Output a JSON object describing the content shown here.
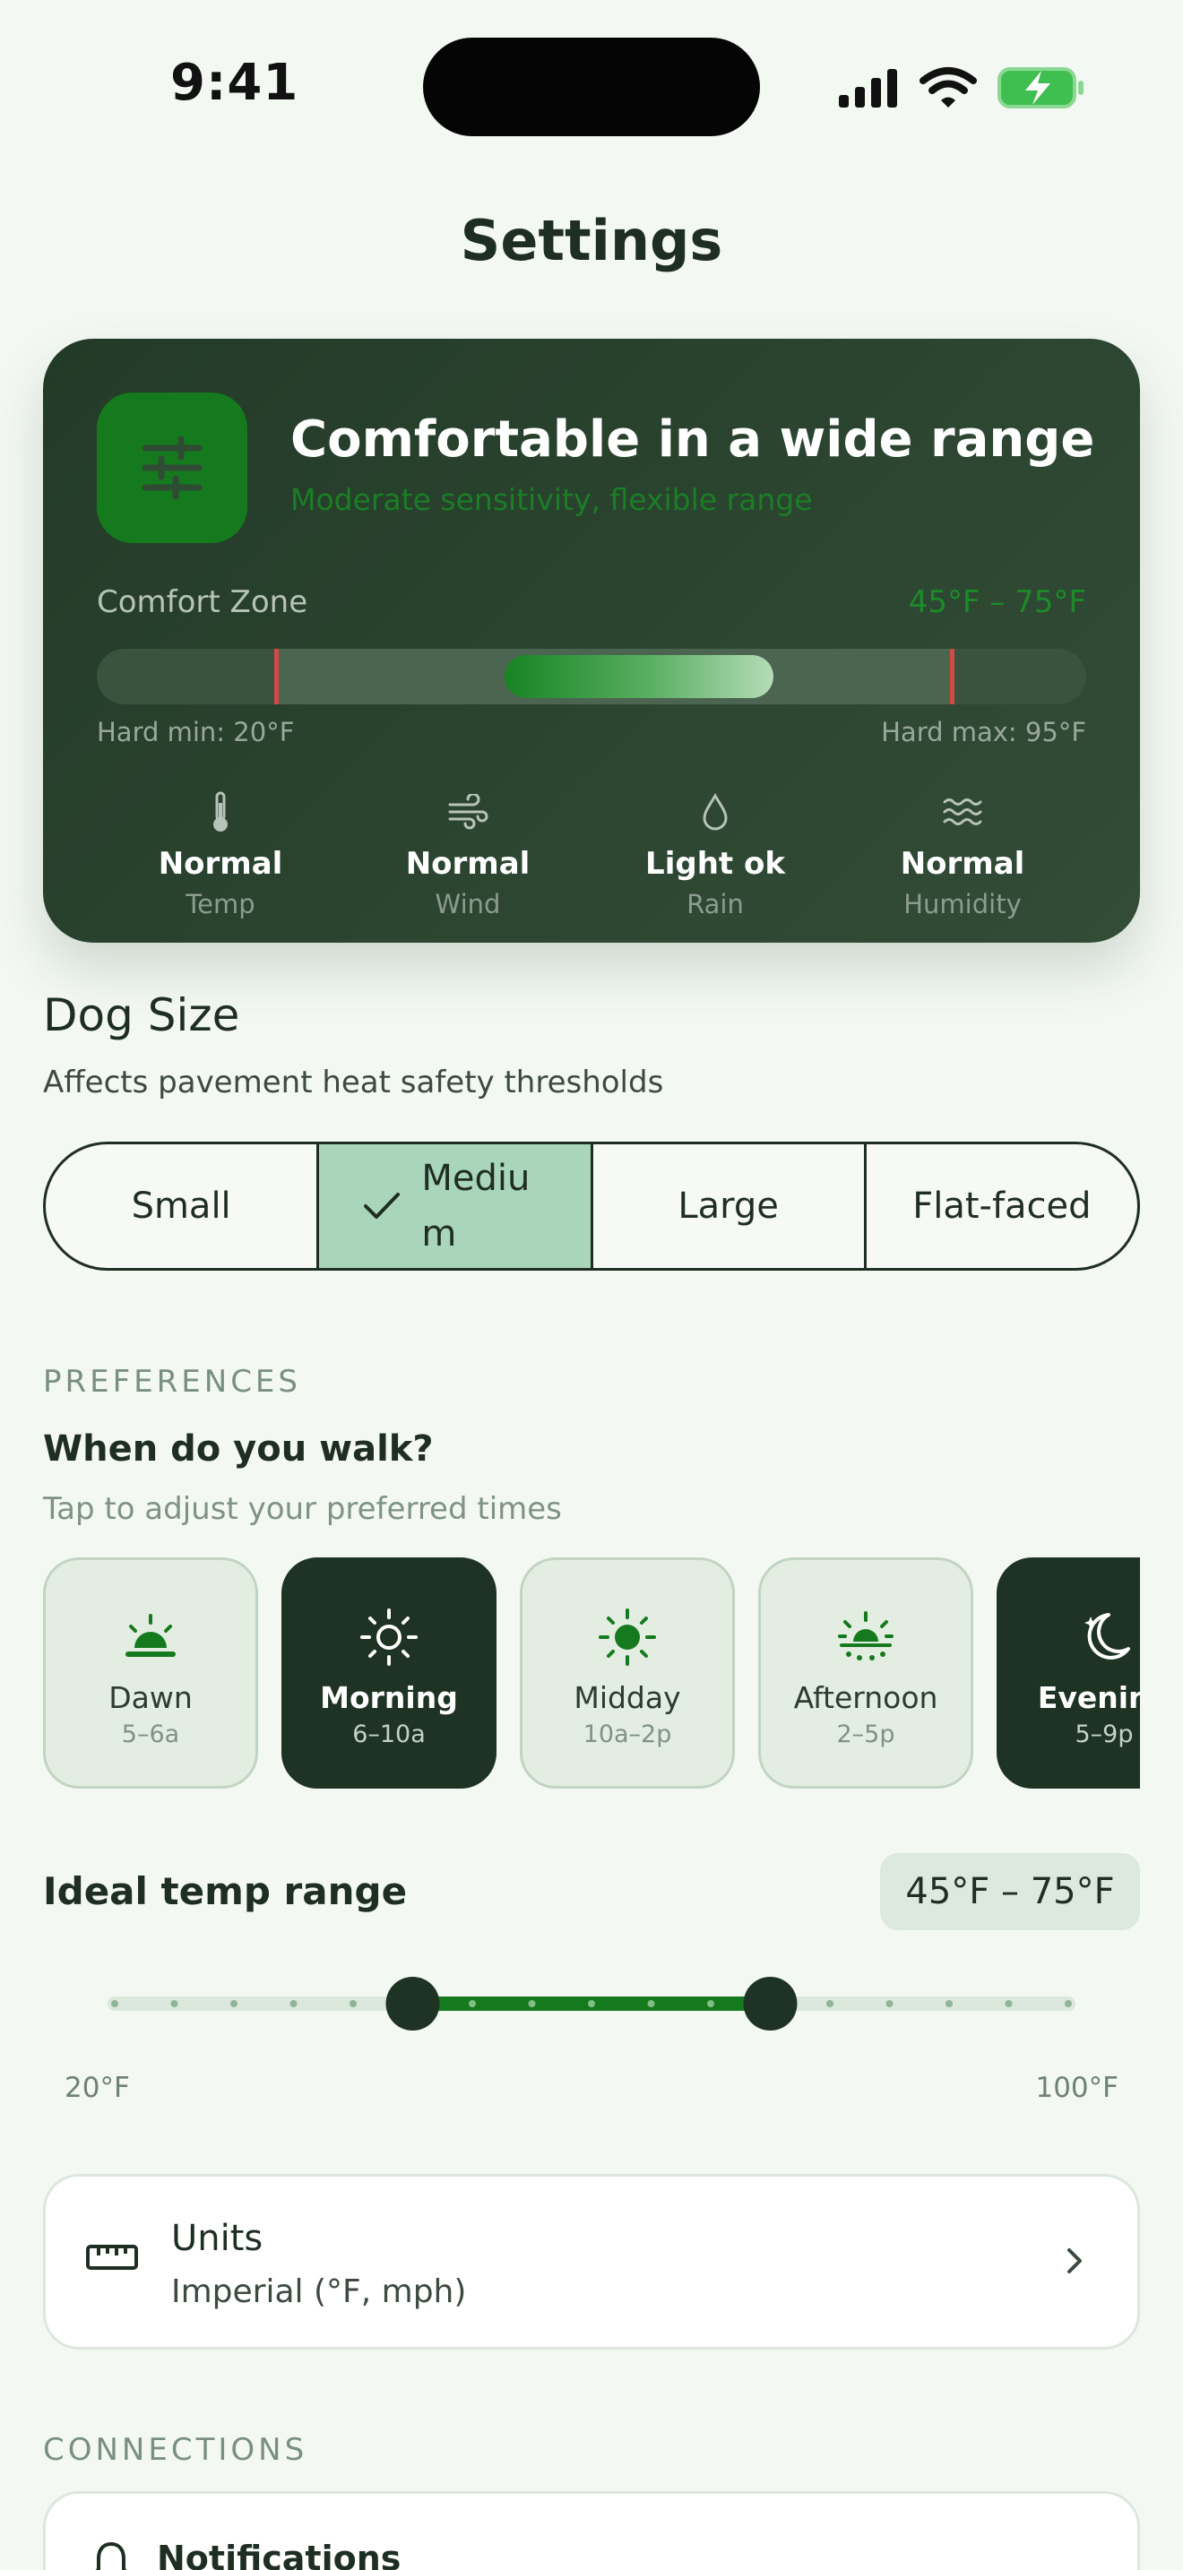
{
  "status_bar": {
    "time": "9:41"
  },
  "page_title": "Settings",
  "comfort_card": {
    "title": "Comfortable in a wide range",
    "subtitle": "Moderate sensitivity, flexible range",
    "zone_label": "Comfort Zone",
    "zone_range": "45°F – 75°F",
    "hard_min": "Hard min: 20°F",
    "hard_max": "Hard max: 95°F",
    "factors": [
      {
        "icon": "thermometer-icon",
        "value": "Normal",
        "label": "Temp"
      },
      {
        "icon": "wind-icon",
        "value": "Normal",
        "label": "Wind"
      },
      {
        "icon": "raindrop-icon",
        "value": "Light ok",
        "label": "Rain"
      },
      {
        "icon": "humidity-waves-icon",
        "value": "Normal",
        "label": "Humidity"
      }
    ]
  },
  "dog_size": {
    "title": "Dog Size",
    "subtitle": "Affects pavement heat safety thresholds",
    "options": [
      "Small",
      "Medium",
      "Large",
      "Flat-faced"
    ],
    "selected": "Medium"
  },
  "preferences": {
    "section_label": "PREFERENCES",
    "walk_title": "When do you walk?",
    "walk_subtitle": "Tap to adjust your preferred times",
    "times": [
      {
        "name": "Dawn",
        "range": "5–6a",
        "icon": "sunrise-icon",
        "selected": false
      },
      {
        "name": "Morning",
        "range": "6–10a",
        "icon": "sun-outline-icon",
        "selected": true
      },
      {
        "name": "Midday",
        "range": "10a–2p",
        "icon": "sun-icon",
        "selected": false
      },
      {
        "name": "Afternoon",
        "range": "2–5p",
        "icon": "sun-low-icon",
        "selected": false
      },
      {
        "name": "Evening",
        "range": "5–9p",
        "icon": "moon-stars-icon",
        "selected": true
      }
    ],
    "temp_title": "Ideal temp range",
    "temp_badge": "45°F – 75°F",
    "temp_slider": {
      "min": 20,
      "max": 100,
      "low": 45,
      "high": 75
    },
    "temp_min_label": "20°F",
    "temp_max_label": "100°F"
  },
  "units": {
    "title": "Units",
    "value": "Imperial (°F, mph)"
  },
  "connections": {
    "section_label": "CONNECTIONS",
    "notifications_title": "Notifications"
  },
  "colors": {
    "accent": "#157a1e",
    "card_dark": "#233a28",
    "background": "#f4f8f3",
    "selected_segment": "#a9d5bb",
    "hard_limit": "#d24a44"
  }
}
